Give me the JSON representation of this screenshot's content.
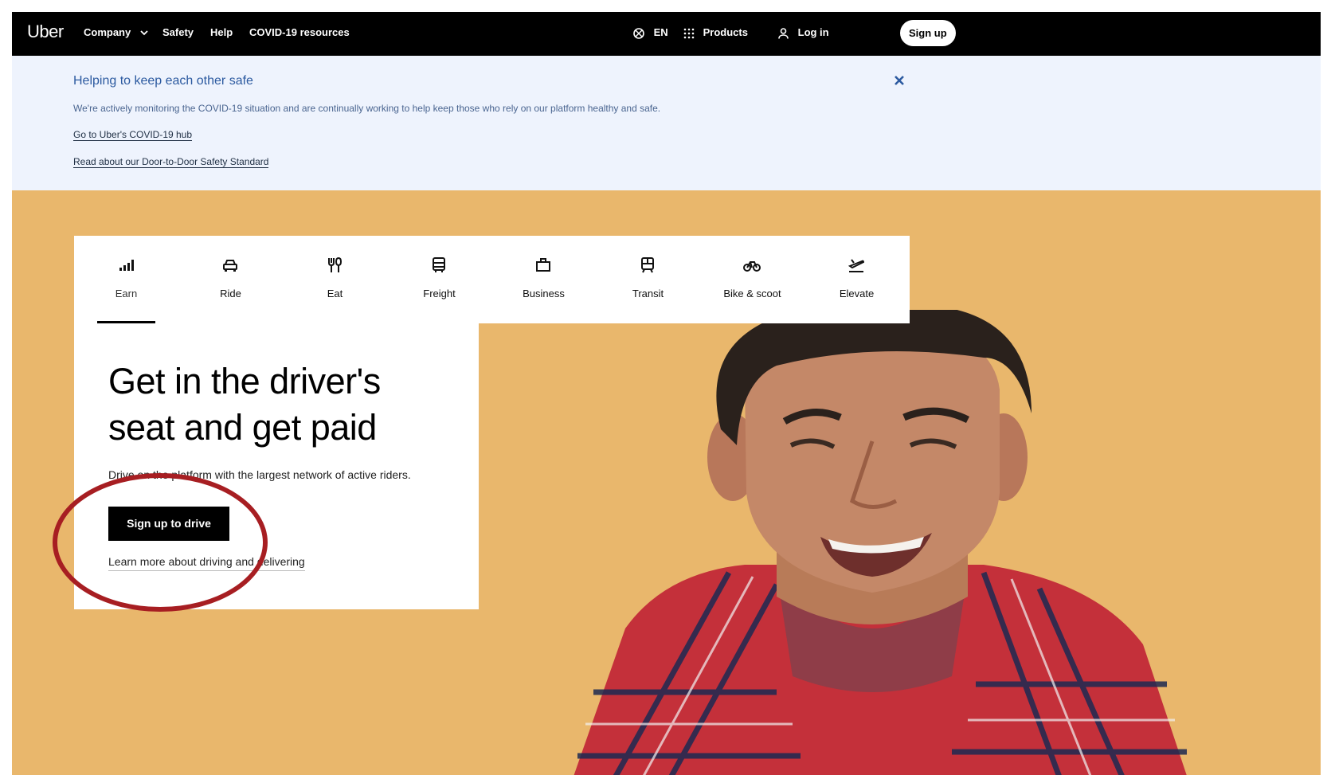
{
  "nav": {
    "logo": "Uber",
    "company": "Company",
    "safety": "Safety",
    "help": "Help",
    "covid": "COVID-19 resources",
    "language": "EN",
    "products": "Products",
    "login": "Log in",
    "signup": "Sign up"
  },
  "banner": {
    "title": "Helping to keep each other safe",
    "description": "We're actively monitoring the COVID-19 situation and are continually working to help keep those who rely on our platform healthy and safe.",
    "link1": "Go to Uber's COVID-19 hub",
    "link2": "Read about our Door-to-Door Safety Standard"
  },
  "tabs": [
    {
      "label": "Earn",
      "icon": "signal-bars-icon",
      "active": true
    },
    {
      "label": "Ride",
      "icon": "car-icon",
      "active": false
    },
    {
      "label": "Eat",
      "icon": "utensils-icon",
      "active": false
    },
    {
      "label": "Freight",
      "icon": "truck-icon",
      "active": false
    },
    {
      "label": "Business",
      "icon": "briefcase-icon",
      "active": false
    },
    {
      "label": "Transit",
      "icon": "train-icon",
      "active": false
    },
    {
      "label": "Bike & scoot",
      "icon": "bike-icon",
      "active": false
    },
    {
      "label": "Elevate",
      "icon": "airplane-icon",
      "active": false
    }
  ],
  "hero": {
    "headline": "Get in the driver's seat and get paid",
    "subtext": "Drive on the platform with the largest network of active riders.",
    "cta": "Sign up to drive",
    "learn_more": "Learn more about driving and delivering"
  },
  "colors": {
    "nav_bg": "#000000",
    "banner_bg": "#eef3fd",
    "hero_bg": "#e9b76c",
    "annotation_circle": "#a71e22"
  }
}
